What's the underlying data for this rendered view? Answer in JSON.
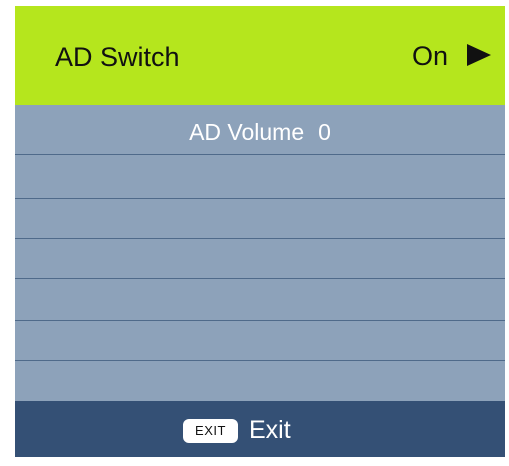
{
  "header": {
    "label": "AD Switch",
    "value": "On",
    "arrow_icon": "right-triangle-icon",
    "background": "#b5e61d"
  },
  "list": {
    "background": "#8da2ba",
    "items": [
      {
        "label": "AD Volume",
        "value": "0"
      }
    ]
  },
  "footer": {
    "key_label": "EXIT",
    "label": "Exit",
    "background": "#345075"
  }
}
